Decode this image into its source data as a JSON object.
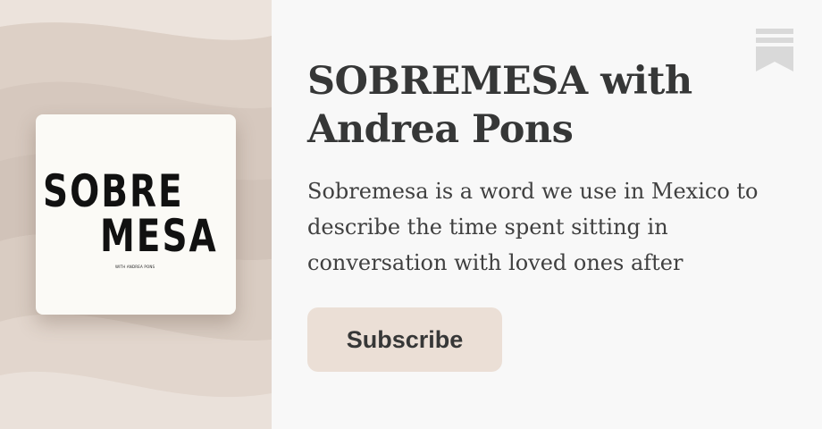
{
  "publication": {
    "title": "SOBREMESA with Andrea Pons",
    "description": "Sobremesa is a word we use in Mexico to describe the time spent sitting in conversation with loved ones after dinner…"
  },
  "cover": {
    "line1": "SOBRE",
    "line2": "MESA",
    "subtitle": "WITH ANDREA PONS"
  },
  "actions": {
    "subscribe_label": "Subscribe"
  },
  "icons": {
    "bookmark": "substack-bookmark-icon"
  },
  "colors": {
    "background": "#f8f8f8",
    "left_panel": "#e3d7ce",
    "button": "#ebdfd6",
    "title_text": "#363737",
    "bookmark": "#d9d9d9"
  }
}
